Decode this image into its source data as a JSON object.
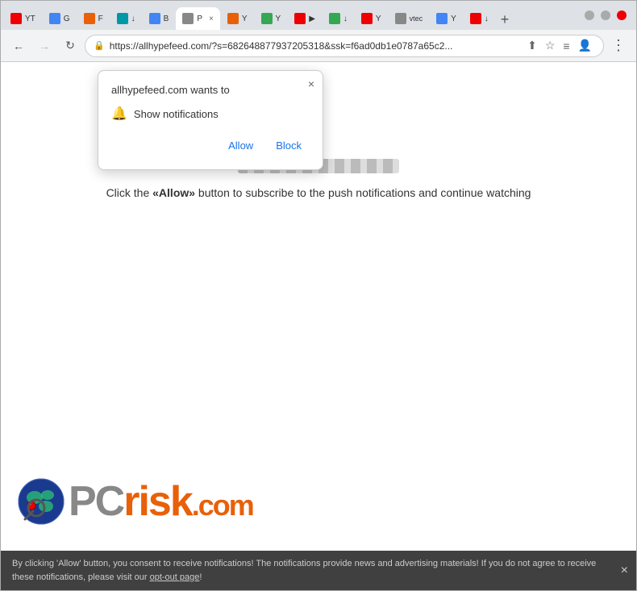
{
  "browser": {
    "tabs": [
      {
        "id": 1,
        "favicon_color": "fav-red",
        "label": "YT",
        "active": false
      },
      {
        "id": 2,
        "favicon_color": "fav-blue",
        "label": "G",
        "active": false
      },
      {
        "id": 3,
        "favicon_color": "fav-orange",
        "label": "F",
        "active": false
      },
      {
        "id": 4,
        "favicon_color": "fav-teal",
        "label": "↓",
        "active": false
      },
      {
        "id": 5,
        "favicon_color": "fav-blue",
        "label": "B",
        "active": false
      },
      {
        "id": 6,
        "favicon_color": "fav-gray",
        "label": "P ×",
        "active": true
      },
      {
        "id": 7,
        "favicon_color": "fav-orange",
        "label": "Y",
        "active": false
      },
      {
        "id": 8,
        "favicon_color": "fav-green",
        "label": "Y",
        "active": false
      },
      {
        "id": 9,
        "favicon_color": "fav-red",
        "label": "▶",
        "active": false
      },
      {
        "id": 10,
        "favicon_color": "fav-green",
        "label": "↓",
        "active": false
      },
      {
        "id": 11,
        "favicon_color": "fav-red",
        "label": "Y",
        "active": false
      },
      {
        "id": 12,
        "favicon_color": "fav-gray",
        "label": "vtec",
        "active": false
      },
      {
        "id": 13,
        "favicon_color": "fav-blue",
        "label": "Y",
        "active": false
      },
      {
        "id": 14,
        "favicon_color": "fav-red",
        "label": "↓",
        "active": false
      }
    ],
    "new_tab_label": "+",
    "url": "https://allhypefeed.com/?s=682648877937205318&ssk=f6ad0db1e0787a65c2...",
    "nav": {
      "back_label": "←",
      "forward_label": "→",
      "reload_label": "↻"
    }
  },
  "popup": {
    "title": "allhypefeed.com wants to",
    "close_label": "×",
    "notification_label": "Show notifications",
    "allow_label": "Allow",
    "block_label": "Block"
  },
  "page": {
    "instruction": "Click the «Allow» button to subscribe to the push notifications and continue watching",
    "instruction_bold_part": "«Allow»"
  },
  "bottom_bar": {
    "text": "By clicking 'Allow' button, you consent to receive notifications! The notifications provide news and advertising materials! If you do not agree to receive these notifications, please visit our ",
    "link_text": "opt-out page",
    "text_end": "!",
    "close_label": "×"
  },
  "pcrisk": {
    "text": "PCrisk.com"
  },
  "colors": {
    "accent_blue": "#1a73e8",
    "tab_bg": "#dee1e6",
    "active_tab_bg": "#ffffff",
    "bottom_bar_bg": "#404040"
  }
}
